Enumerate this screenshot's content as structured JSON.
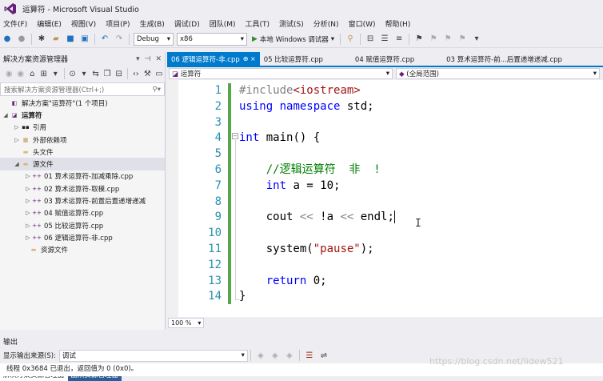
{
  "window": {
    "title": "运算符 - Microsoft Visual Studio"
  },
  "menu": [
    "文件(F)",
    "编辑(E)",
    "视图(V)",
    "项目(P)",
    "生成(B)",
    "调试(D)",
    "团队(M)",
    "工具(T)",
    "测试(S)",
    "分析(N)",
    "窗口(W)",
    "帮助(H)"
  ],
  "toolbar": {
    "config": "Debug",
    "platform": "x86",
    "run_label": "本地 Windows 调试器"
  },
  "solution_explorer": {
    "title": "解决方案资源管理器",
    "search_placeholder": "搜索解决方案资源管理器(Ctrl+;)",
    "solution": "解决方案\"运算符\"(1 个项目)",
    "project": "运算符",
    "references": "引用",
    "external_deps": "外部依赖项",
    "headers": "头文件",
    "sources": "源文件",
    "files": [
      "01 算术运算符-加减乘除.cpp",
      "02 算术运算符-取模.cpp",
      "03 算术运算符-前置后置递增递减",
      "04 赋值运算符.cpp",
      "05 比较运算符.cpp",
      "06 逻辑运算符-非.cpp"
    ],
    "resources": "资源文件",
    "bottom_tabs": [
      "解决方案资源管理器",
      "团队资源管理器"
    ]
  },
  "editor": {
    "tabs": [
      "06 逻辑运算符-非.cpp",
      "05 比较运算符.cpp",
      "04 赋值运算符.cpp",
      "03 算术运算符-前...后置递增递减.cpp"
    ],
    "active_tab_pin": "⊕ ×",
    "nav_project": "运算符",
    "nav_scope": "(全局范围)",
    "zoom": "100 %",
    "line_numbers": [
      "1",
      "2",
      "3",
      "4",
      "5",
      "6",
      "7",
      "8",
      "9",
      "10",
      "11",
      "12",
      "13",
      "14"
    ],
    "code": {
      "l1_pp": "#include",
      "l1_hdr": "<iostream>",
      "l2_kw1": "using",
      "l2_kw2": "namespace",
      "l2_rest": " std;",
      "l4_kw": "int",
      "l4_rest": " main() {",
      "l6_cm": "//逻辑运算符  非  !",
      "l7_kw": "int",
      "l7_rest": " a = 10;",
      "l9_a": "cout ",
      "l9_op1": "<<",
      "l9_b": " !a ",
      "l9_op2": "<<",
      "l9_c": " endl;",
      "l11_a": "system(",
      "l11_str": "\"pause\"",
      "l11_b": ");",
      "l13_kw": "return",
      "l13_rest": " 0;",
      "l14": "}"
    }
  },
  "output": {
    "title": "输出",
    "source_label": "显示输出来源(S):",
    "source_value": "调试",
    "text": "线程 0x3684 已退出，返回值为 0 (0x0)。",
    "watermark": "https://blog.csdn.net/lidew521"
  }
}
